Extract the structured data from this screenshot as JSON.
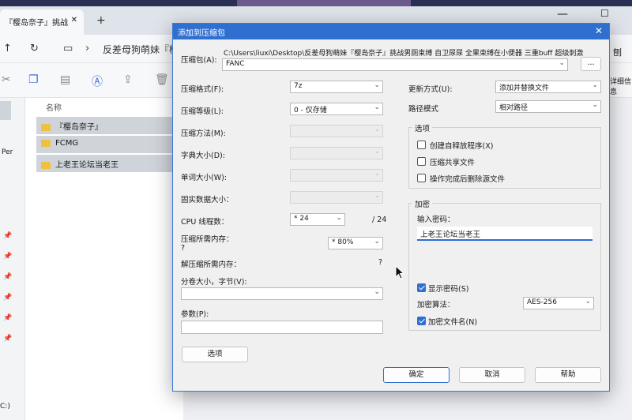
{
  "explorer": {
    "tab_title": "『樱岛奈子』挑战",
    "tab_close": "✕",
    "new_tab": "+",
    "breadcrumb": "反差母狗萌妹『樱",
    "column_name": "名称",
    "files": [
      "『樱岛奈子』",
      "FCMG",
      "上老王论坛当老王"
    ],
    "left_partial_label": "Per",
    "drive_label": "C:)",
    "right_partial_label": "详细信息",
    "right_partial_char": "刨"
  },
  "dialog": {
    "title": "添加到压缩包",
    "close": "✕",
    "archive_label": "压缩包(A):",
    "archive_path": "C:\\Users\\liuxi\\Desktop\\反差母狗萌妹『樱岛奈子』挑战男厕束缚 自卫尿尿 全果束缚在小便器 三重buff 超级刺激",
    "archive_name": "FANC",
    "browse": "...",
    "format_label": "压缩格式(F):",
    "format_value": "7z",
    "level_label": "压缩等级(L):",
    "level_value": "0 - 仅存储",
    "method_label": "压缩方法(M):",
    "dict_label": "字典大小(D):",
    "word_label": "单词大小(W):",
    "solid_label": "固实数据大小：",
    "cpu_label": "CPU 线程数：",
    "cpu_value": "* 24",
    "cpu_total": "/ 24",
    "mem_label": "压缩所需内存：",
    "mem_q": "?",
    "mem_value": "* 80%",
    "demem_label": "解压缩所需内存：",
    "demem_q": "?",
    "split_label": "分卷大小，字节(V):",
    "params_label": "参数(P):",
    "options_button": "选项",
    "update_label": "更新方式(U):",
    "update_value": "添加并替换文件",
    "path_label": "路径模式",
    "path_value": "相对路径",
    "options_group": "选项",
    "opt_sfx": "创建自释放程序(X)",
    "opt_shared": "压缩共享文件",
    "opt_delete": "操作完成后删除源文件",
    "enc_group": "加密",
    "pwd_label": "输入密码：",
    "pwd_value": "上老王论坛当老王",
    "show_pwd": "显示密码(S)",
    "enc_method_label": "加密算法：",
    "enc_method_value": "AES-256",
    "enc_names": "加密文件名(N)",
    "ok": "确定",
    "cancel": "取消",
    "help": "帮助"
  },
  "icons": {
    "dropdown": "⌄"
  }
}
